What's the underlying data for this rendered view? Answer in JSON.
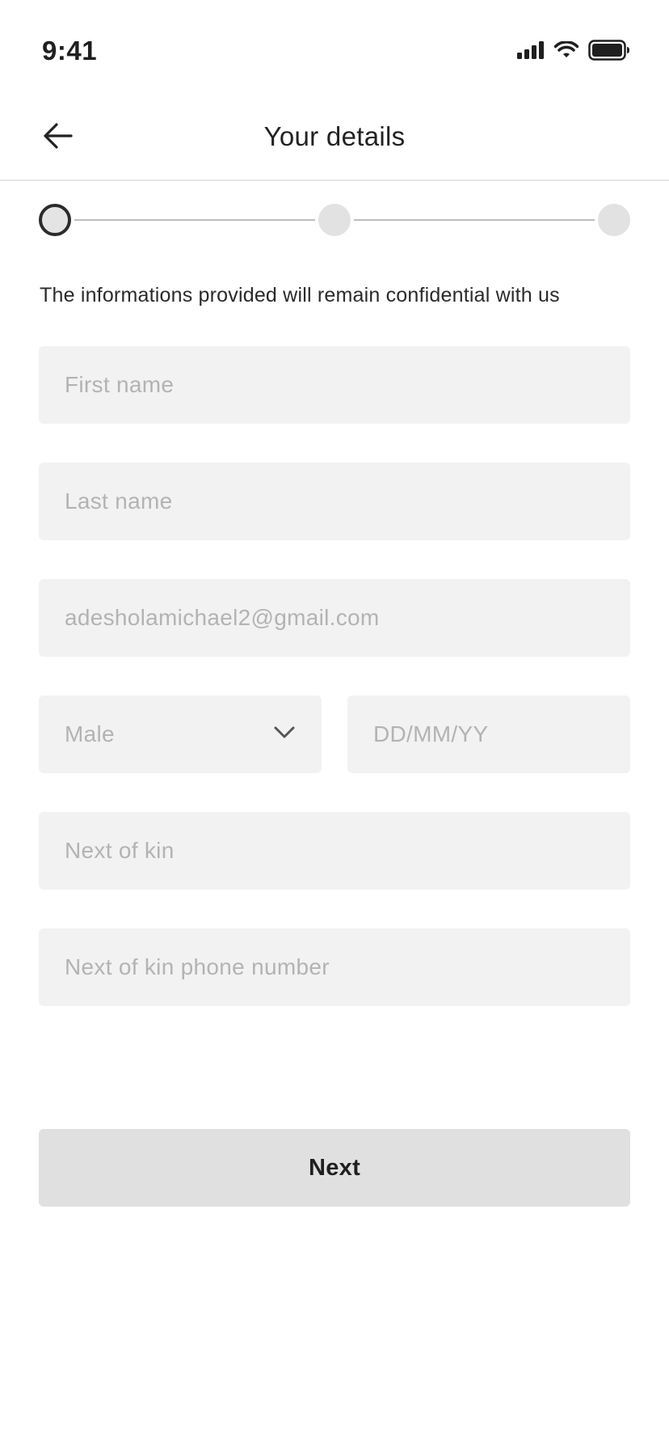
{
  "status_bar": {
    "time": "9:41",
    "icons": [
      "signal-icon",
      "wifi-icon",
      "battery-icon"
    ]
  },
  "header": {
    "title": "Your details",
    "back_icon": "arrow-left-icon"
  },
  "stepper": {
    "total_steps": 3,
    "current_step": 1
  },
  "info_text": "The informations provided will remain confidential with us",
  "form": {
    "first_name": {
      "placeholder": "First name",
      "value": ""
    },
    "last_name": {
      "placeholder": "Last name",
      "value": ""
    },
    "email": {
      "placeholder": "adesholamichael2@gmail.com",
      "value": ""
    },
    "gender": {
      "selected": "Male",
      "icon": "chevron-down-icon"
    },
    "dob": {
      "placeholder": "DD/MM/YY",
      "value": ""
    },
    "next_of_kin": {
      "placeholder": "Next of kin",
      "value": ""
    },
    "next_of_kin_phone": {
      "placeholder": "Next of kin phone number",
      "value": ""
    }
  },
  "next_button": {
    "label": "Next"
  },
  "colors": {
    "field_bg": "#f2f2f2",
    "placeholder": "#b3b3b3",
    "button_bg": "#e0e0e0",
    "text": "#222222",
    "step_active_border": "#2b2b2b",
    "step_inactive": "#e2e2e2"
  }
}
